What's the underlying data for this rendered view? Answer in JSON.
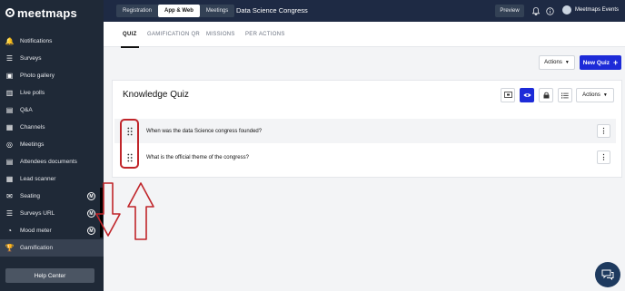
{
  "brand": {
    "name": "meetmaps"
  },
  "sidebar": {
    "items": [
      {
        "label": "Notifications",
        "icon": "bell-icon",
        "glyph": "🔔"
      },
      {
        "label": "Surveys",
        "icon": "list-icon",
        "glyph": "☰"
      },
      {
        "label": "Photo gallery",
        "icon": "image-icon",
        "glyph": "▣"
      },
      {
        "label": "Live polls",
        "icon": "poll-icon",
        "glyph": "▥"
      },
      {
        "label": "Q&A",
        "icon": "chat-icon",
        "glyph": "▤"
      },
      {
        "label": "Channels",
        "icon": "channels-icon",
        "glyph": "▦"
      },
      {
        "label": "Meetings",
        "icon": "handshake-icon",
        "glyph": "◎"
      },
      {
        "label": "Attendees documents",
        "icon": "document-icon",
        "glyph": "▤"
      },
      {
        "label": "Lead scanner",
        "icon": "qr-icon",
        "glyph": "▦"
      },
      {
        "label": "Seating",
        "icon": "mail-icon",
        "glyph": "✉",
        "badge": "M"
      },
      {
        "label": "Surveys URL",
        "icon": "list-icon",
        "glyph": "☰",
        "badge": "M"
      },
      {
        "label": "Mood meter",
        "icon": "mood-icon",
        "glyph": "◔",
        "badge": "M"
      },
      {
        "label": "Gamification",
        "icon": "trophy-icon",
        "glyph": "🏆",
        "active": true
      }
    ],
    "help_label": "Help Center"
  },
  "topbar": {
    "segments": [
      "Registration",
      "App & Web",
      "Meetings"
    ],
    "active_segment": "App & Web",
    "event_title": "Data Science Congress",
    "preview_label": "Preview",
    "user_name": "Meetmaps Events"
  },
  "tabs": [
    "QUIZ",
    "GAMIFICATION QR",
    "MISSIONS",
    "PER ACTIONS"
  ],
  "active_tab": "QUIZ",
  "toolbar": {
    "actions_label": "Actions",
    "new_quiz_label": "New Quiz"
  },
  "quiz": {
    "title": "Knowledge Quiz",
    "actions_label": "Actions",
    "questions": [
      "When was the data Science congress founded?",
      "What is the official theme of the congress?"
    ]
  },
  "colors": {
    "sidebar_bg": "#1f2937",
    "topbar_bg": "#1e2a44",
    "primary": "#1d2bd8",
    "annotation": "#c0252a"
  }
}
